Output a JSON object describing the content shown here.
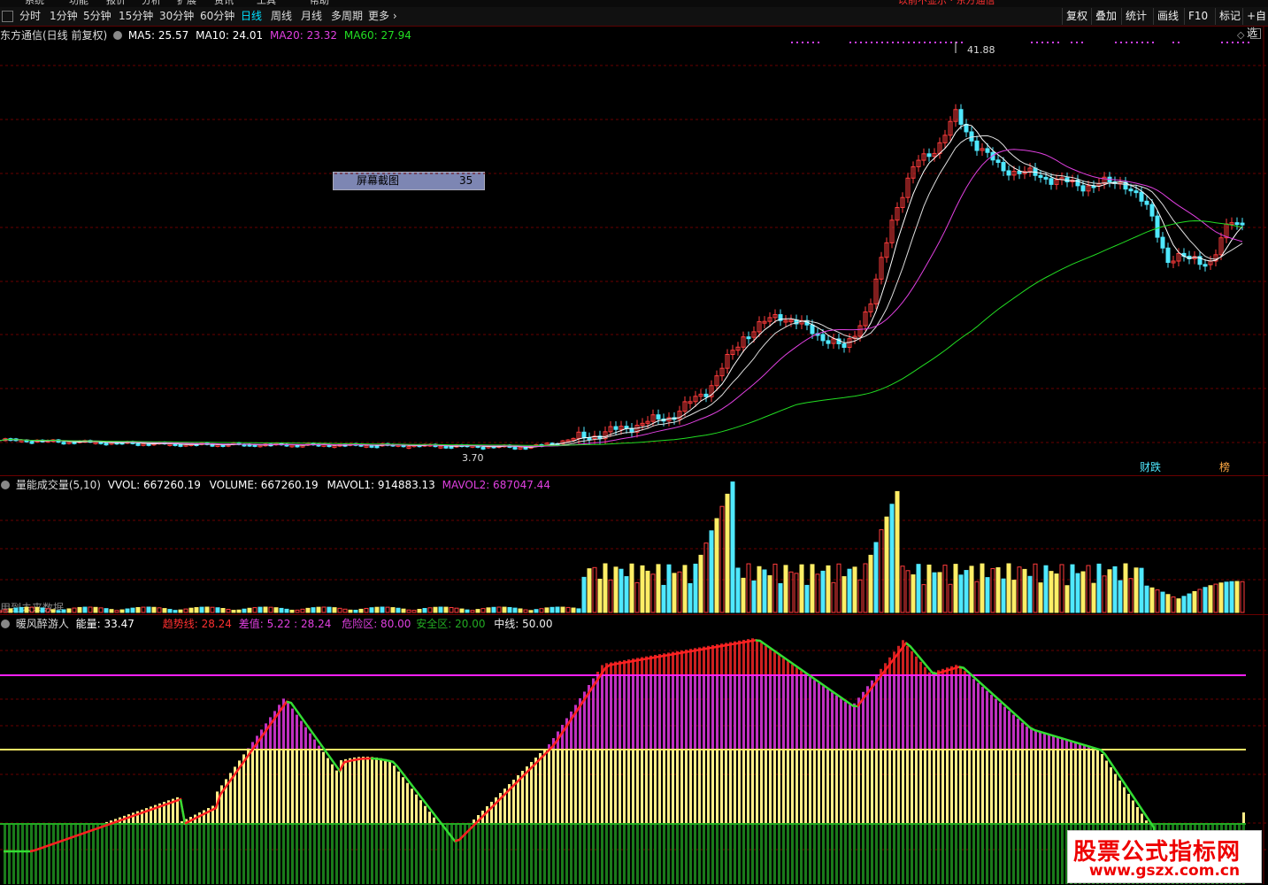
{
  "menu": {
    "items": [
      "系统",
      "功能",
      "报价",
      "分析",
      "扩展",
      "资讯",
      "工具",
      "帮助"
    ],
    "notice": "以前不显示 · 东方通信"
  },
  "periods": {
    "items": [
      "分时",
      "1分钟",
      "5分钟",
      "15分钟",
      "30分钟",
      "60分钟",
      "日线",
      "周线",
      "月线",
      "多周期",
      "更多"
    ],
    "active": "日线"
  },
  "right_tools": [
    "复权",
    "叠加",
    "统计",
    "画线",
    "F10",
    "标记",
    "+自选"
  ],
  "price_panel": {
    "stock_title": "东方通信(日线 前复权)",
    "ma5": "MA5: 25.57",
    "ma10": "MA10: 24.01",
    "ma20": "MA20: 23.32",
    "ma60": "MA60: 27.94",
    "high_label": "41.88",
    "low_label": "3.70",
    "badge_fin": "财跌",
    "badge_rank": "榜"
  },
  "screenshot_box": {
    "label": "屏幕截图",
    "value": "35"
  },
  "volume_panel": {
    "title": "量能成交量(5,10)",
    "vvol": "VVOL: 667260.19",
    "volume": "VOLUME: 667260.19",
    "mavol1": "MAVOL1: 914883.13",
    "mavol2": "MAVOL2: 687047.44",
    "future_note": "用到未来数据"
  },
  "indicator_panel": {
    "title": "暖风醉游人",
    "energy": "能量: 33.47",
    "trend": "趋势线: 28.24",
    "diff": "差值: 5.22 : 28.24",
    "danger": "危险区: 80.00",
    "safe": "安全区: 20.00",
    "mid": "中线: 50.00"
  },
  "watermark": {
    "title": "股票公式指标网",
    "url": "www.gszx.com.cn"
  },
  "colors": {
    "up": "#ff3b3b",
    "down": "#4fe8ff",
    "ma5": "#ffffff",
    "ma10": "#ffff66",
    "ma20": "#e040e0",
    "ma60": "#22dd22",
    "grid": "#6a0000"
  }
}
